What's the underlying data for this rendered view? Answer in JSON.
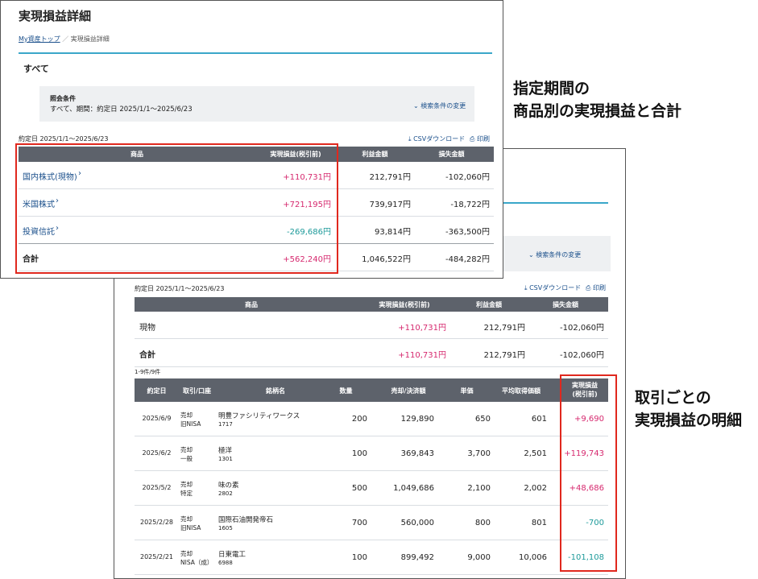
{
  "back": {
    "period": "約定日 2025/1/1〜2025/6/23",
    "csv_label": "CSVダウンロード",
    "print_label": "印刷",
    "filter_change_label": "検索条件の変更",
    "summary_headers": [
      "商品",
      "実現損益(税引前)",
      "利益金額",
      "損失金額"
    ],
    "summary_rows": [
      {
        "name": "現物",
        "pl": "+110,731円",
        "profit": "212,791円",
        "loss": "-102,060円"
      },
      {
        "name": "合計",
        "pl": "+110,731円",
        "profit": "212,791円",
        "loss": "-102,060円"
      }
    ],
    "count_label": "1-9件/9件",
    "detail_headers": [
      "約定日",
      "取引/口座",
      "銘柄名",
      "数量",
      "売却/決済額",
      "単価",
      "平均取得価額",
      "実現損益\n(税引前)"
    ],
    "detail_rows": [
      {
        "date": "2025/6/9",
        "trade": "売却",
        "account": "旧NISA",
        "name": "明豊ファシリティワークス",
        "code": "1717",
        "qty": "200",
        "amount": "129,890",
        "price": "650",
        "avg": "601",
        "pl": "+9,690",
        "sign": "pos"
      },
      {
        "date": "2025/6/2",
        "trade": "売却",
        "account": "一般",
        "name": "極洋",
        "code": "1301",
        "qty": "100",
        "amount": "369,843",
        "price": "3,700",
        "avg": "2,501",
        "pl": "+119,743",
        "sign": "pos"
      },
      {
        "date": "2025/5/2",
        "trade": "売却",
        "account": "特定",
        "name": "味の素",
        "code": "2802",
        "qty": "500",
        "amount": "1,049,686",
        "price": "2,100",
        "avg": "2,002",
        "pl": "+48,686",
        "sign": "pos"
      },
      {
        "date": "2025/2/28",
        "trade": "売却",
        "account": "旧NISA",
        "name": "国際石油開発帝石",
        "code": "1605",
        "qty": "700",
        "amount": "560,000",
        "price": "800",
        "avg": "801",
        "pl": "-700",
        "sign": "neg"
      },
      {
        "date": "2025/2/21",
        "trade": "売却",
        "account": "NISA（成）",
        "name": "日東電工",
        "code": "6988",
        "qty": "100",
        "amount": "899,492",
        "price": "9,000",
        "avg": "10,006",
        "pl": "-101,108",
        "sign": "neg"
      }
    ]
  },
  "front": {
    "page_title": "実現損益詳細",
    "breadcrumb_home": "My資産トップ",
    "breadcrumb_sep": "／",
    "breadcrumb_current": "実現損益詳細",
    "section_title": "すべて",
    "filter_title": "照会条件",
    "filter_text": "すべて、期間：約定日 2025/1/1〜2025/6/23",
    "filter_change_label": "検索条件の変更",
    "period": "約定日 2025/1/1〜2025/6/23",
    "csv_label": "CSVダウンロード",
    "print_label": "印刷",
    "headers": [
      "商品",
      "実現損益(税引前)",
      "利益金額",
      "損失金額"
    ],
    "rows": [
      {
        "name": "国内株式(現物)",
        "pl": "+110,731円",
        "profit": "212,791円",
        "loss": "-102,060円",
        "sign": "pos"
      },
      {
        "name": "米国株式",
        "pl": "+721,195円",
        "profit": "739,917円",
        "loss": "-18,722円",
        "sign": "pos"
      },
      {
        "name": "投資信託",
        "pl": "-269,686円",
        "profit": "93,814円",
        "loss": "-363,500円",
        "sign": "neg"
      }
    ],
    "total": {
      "name": "合計",
      "pl": "+562,240円",
      "profit": "1,046,522円",
      "loss": "-484,282円"
    }
  },
  "annotations": {
    "top": [
      "指定期間の",
      "商品別の実現損益と合計"
    ],
    "bottom": [
      "取引ごとの",
      "実現損益の明細"
    ]
  },
  "colors": {
    "positive": "#d6286e",
    "negative": "#1d9a9a",
    "header": "#5d626b",
    "highlight": "#e0281e",
    "accent_line": "#3aa7c9"
  }
}
